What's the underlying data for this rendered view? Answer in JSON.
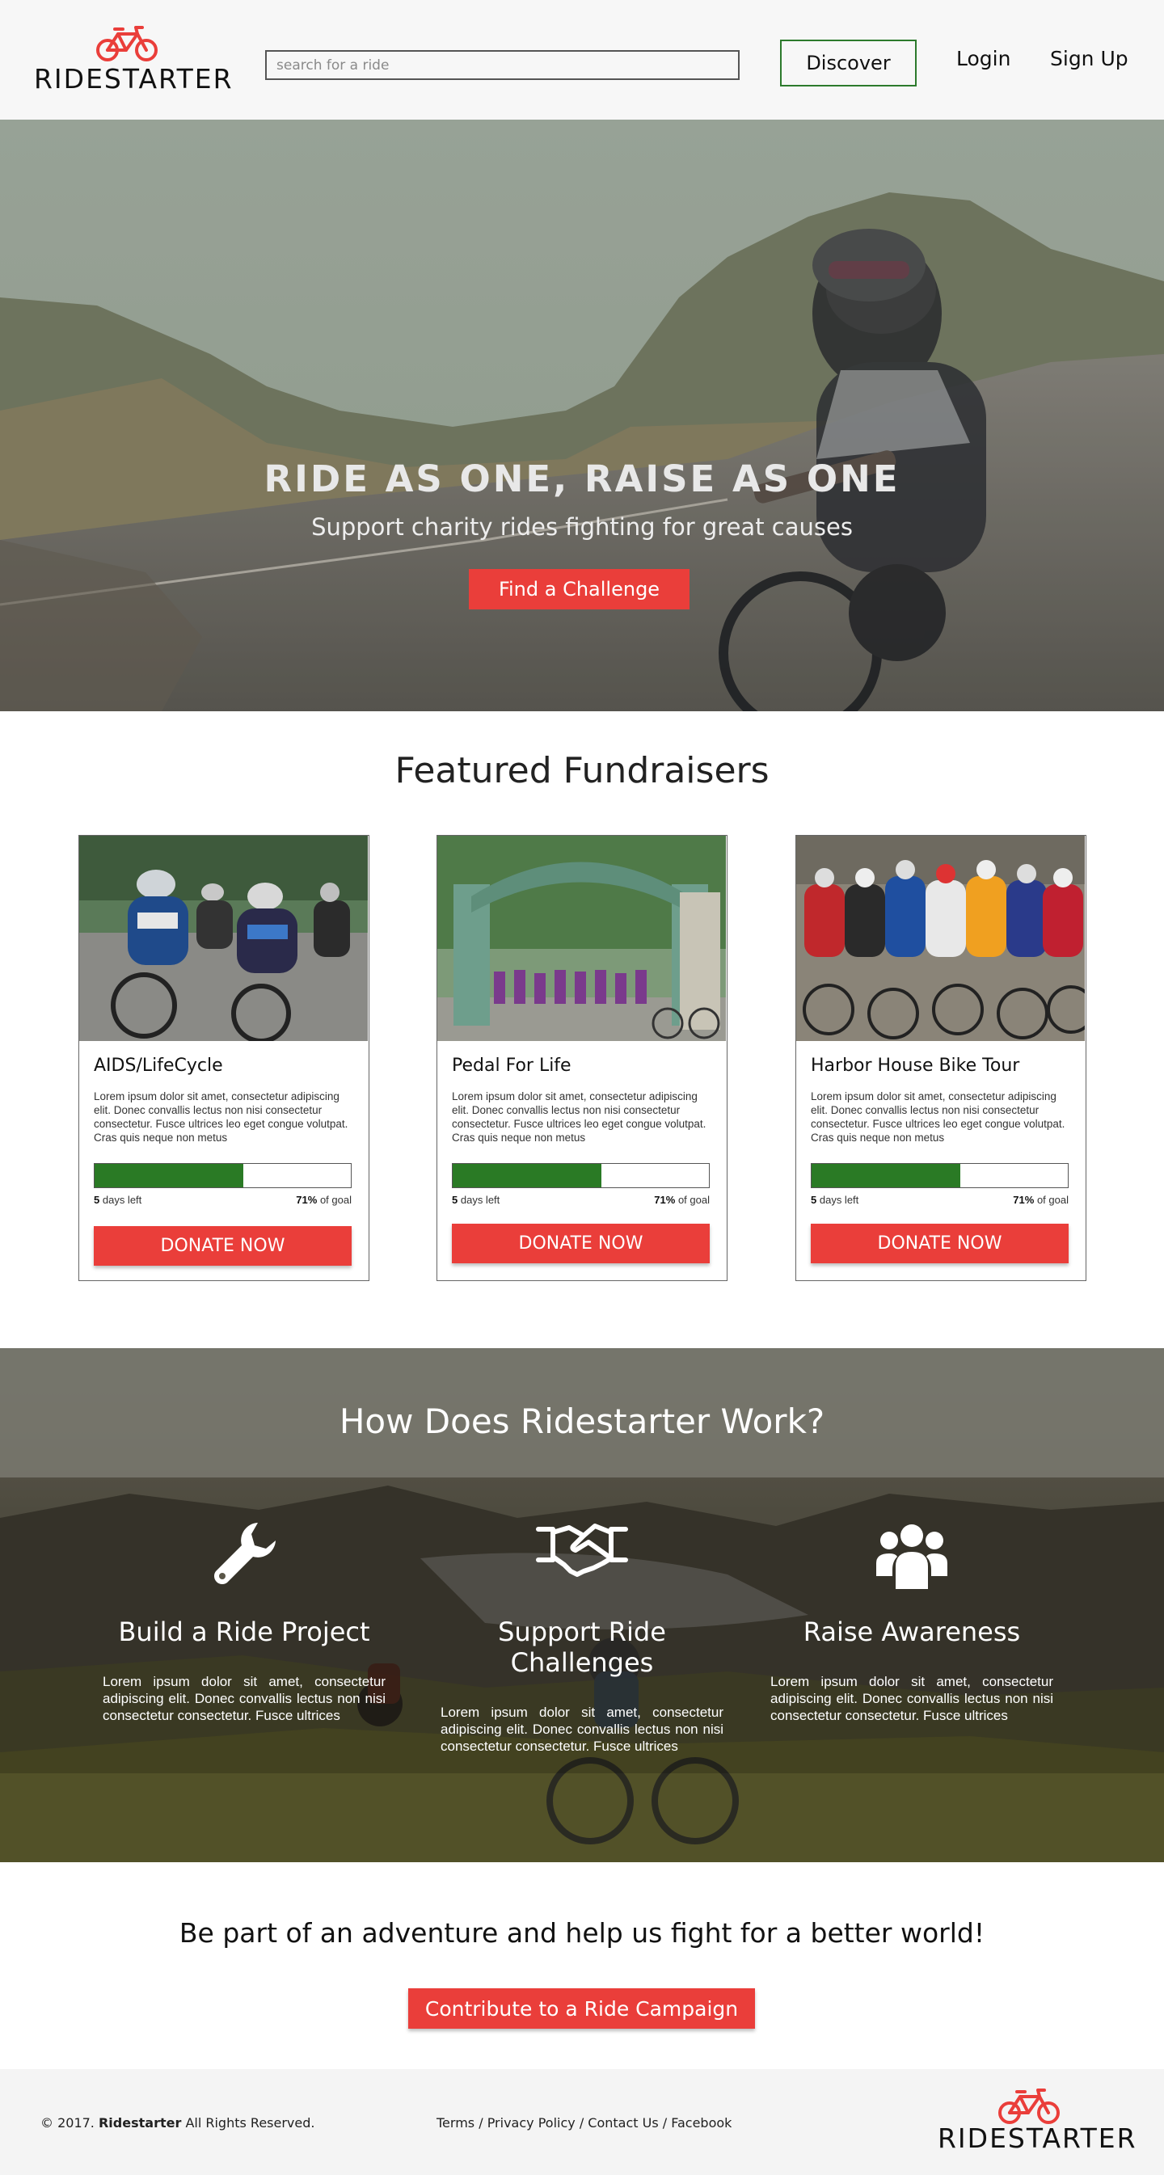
{
  "brand": {
    "name": "RIDESTARTER",
    "accent_color": "#ea3e3a",
    "green_color": "#2a7a25"
  },
  "header": {
    "search_placeholder": "search for a ride",
    "discover_label": "Discover",
    "login_label": "Login",
    "signup_label": "Sign Up"
  },
  "hero": {
    "title": "RIDE AS ONE, RAISE AS ONE",
    "subtitle": "Support charity rides fighting for great causes",
    "button_label": "Find a Challenge"
  },
  "featured": {
    "title": "Featured Fundraisers",
    "cards": [
      {
        "title": "AIDS/LifeCycle",
        "description": "Lorem ipsum dolor sit amet, consectetur adipiscing elit. Donec convallis lectus non nisi consectetur consectetur. Fusce ultrices leo eget congue volutpat. Cras quis neque non metus",
        "progress": 0.58,
        "days_number": "5",
        "days_text": "days left",
        "goal_percent": "71%",
        "goal_text": "of goal",
        "donate_label": "DONATE NOW",
        "image": "group-of-cyclists-photo"
      },
      {
        "title": "Pedal For Life",
        "description": "Lorem ipsum dolor sit amet, consectetur adipiscing elit. Donec convallis lectus non nisi consectetur consectetur. Fusce ultrices leo eget congue volutpat. Cras quis neque non metus",
        "progress": 0.58,
        "days_number": "5",
        "days_text": "days left",
        "goal_percent": "71%",
        "goal_text": "of goal",
        "donate_label": "DONATE NOW",
        "image": "gate-group-photo"
      },
      {
        "title": "Harbor House Bike Tour",
        "description": "Lorem ipsum dolor sit amet, consectetur adipiscing elit. Donec convallis lectus non nisi consectetur consectetur. Fusce ultrices leo eget congue volutpat. Cras quis neque non metus",
        "progress": 0.58,
        "days_number": "5",
        "days_text": "days left",
        "goal_percent": "71%",
        "goal_text": "of goal",
        "donate_label": "DONATE NOW",
        "image": "peloton-photo"
      }
    ]
  },
  "how": {
    "title": "How Does Ridestarter Work?",
    "columns": [
      {
        "icon": "wrench-icon",
        "title": "Build a Ride Project",
        "text": "Lorem ipsum dolor sit amet, consectetur adipiscing elit. Donec convallis lectus non nisi consectetur consectetur. Fusce ultrices"
      },
      {
        "icon": "handshake-icon",
        "title": "Support Ride Challenges",
        "text": "Lorem ipsum dolor sit amet, consectetur adipiscing elit. Donec convallis lectus non nisi consectetur consectetur. Fusce ultrices"
      },
      {
        "icon": "users-icon",
        "title": "Raise Awareness",
        "text": "Lorem ipsum dolor sit amet, consectetur adipiscing elit. Donec convallis lectus non nisi consectetur consectetur. Fusce ultrices"
      }
    ]
  },
  "cta": {
    "title": "Be part of an adventure and help us fight for a better world!",
    "button_label": "Contribute to a Ride Campaign"
  },
  "footer": {
    "copy_prefix": "© 2017.",
    "copy_brand": "Ridestarter",
    "copy_suffix": "All Rights Reserved.",
    "links": [
      "Terms",
      "Privacy Policy",
      "Contact Us",
      "Facebook"
    ],
    "separator": " / "
  }
}
